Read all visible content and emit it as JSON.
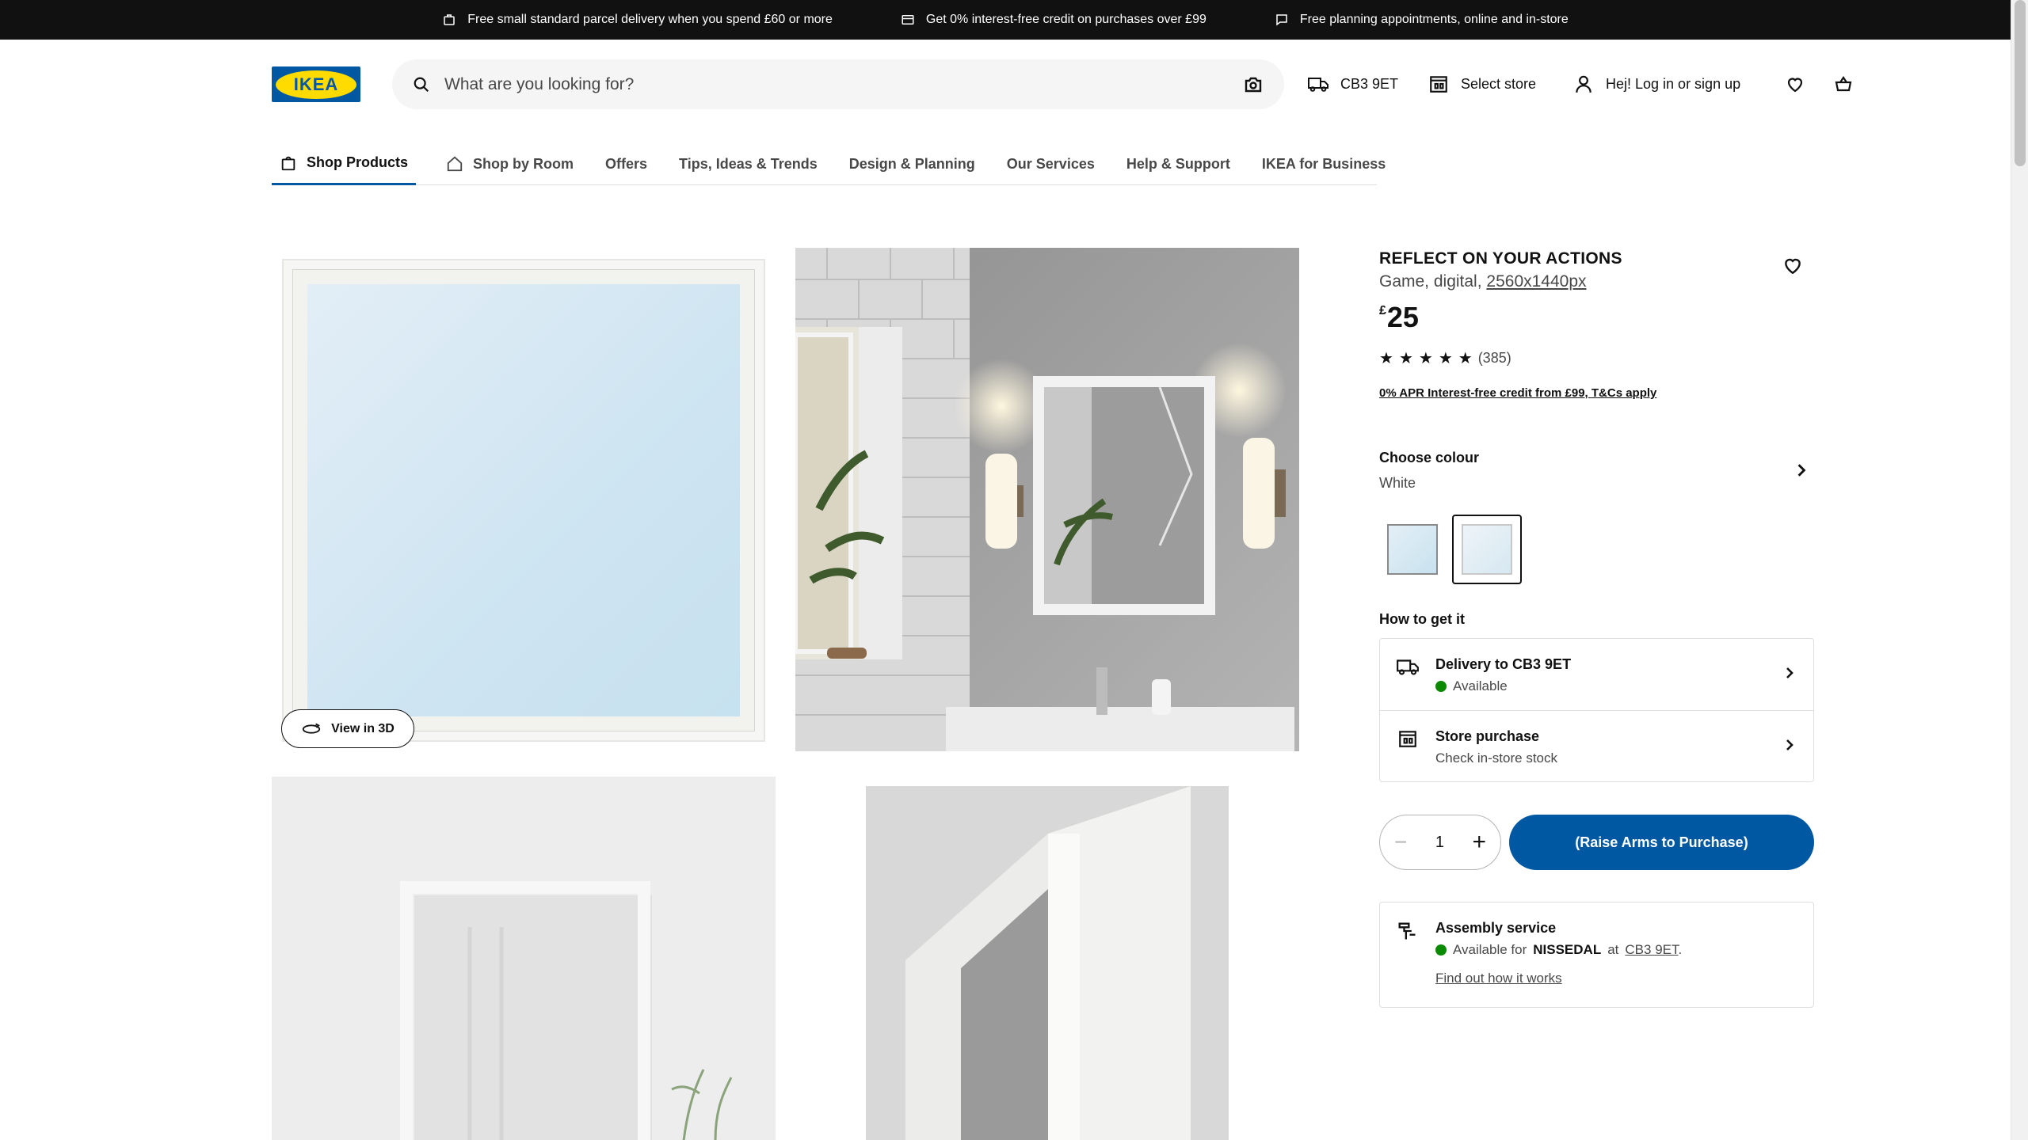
{
  "topbar": {
    "messages": [
      {
        "icon": "parcel-icon",
        "text": "Free small standard parcel delivery when you spend £60 or more"
      },
      {
        "icon": "credit-card-icon",
        "text": "Get 0% interest-free credit on purchases over £99"
      },
      {
        "icon": "chat-icon",
        "text": "Free planning appointments, online and in-store"
      }
    ]
  },
  "header": {
    "logo_text": "IKEA",
    "search_placeholder": "What are you looking for?",
    "postcode": "CB3 9ET",
    "store": "Select store",
    "login": "Hej! Log in or sign up"
  },
  "nav": {
    "tabs": [
      {
        "label": "Shop Products",
        "icon": "bag-icon"
      },
      {
        "label": "Shop by Room",
        "icon": "house-icon"
      },
      {
        "label": "Offers"
      },
      {
        "label": "Tips, Ideas & Trends"
      },
      {
        "label": "Design & Planning"
      },
      {
        "label": "Our Services"
      },
      {
        "label": "Help & Support"
      },
      {
        "label": "IKEA for Business"
      }
    ]
  },
  "gallery": {
    "view_3d_label": "View in 3D"
  },
  "product": {
    "title": "REFLECT ON YOUR ACTIONS",
    "subtitle": "Game, digital,",
    "size_link": "2560x1440px",
    "currency": "£",
    "price": "25",
    "rating_stars": 5,
    "reviews": "(385)",
    "credit_link": "0% APR Interest-free credit from £99, T&Cs apply",
    "choose_colour": "Choose colour",
    "colour": "White",
    "how_to_get": "How to get it",
    "delivery_title": "Delivery to CB3 9ET",
    "delivery_status": "Available",
    "store_title": "Store purchase",
    "store_status": "Check in-store stock",
    "quantity": "1",
    "buy_label": "(Raise Arms to Purchase)",
    "assembly_title": "Assembly service",
    "assembly_prefix": "Available for",
    "assembly_product": "NISSEDAL",
    "assembly_at": "at",
    "assembly_postcode": "CB3 9ET",
    "assembly_period": ".",
    "assembly_link": "Find out how it works"
  },
  "colors": {
    "brand_blue": "#0058a3",
    "brand_yellow": "#ffdb00",
    "available_green": "#0a8a00"
  }
}
